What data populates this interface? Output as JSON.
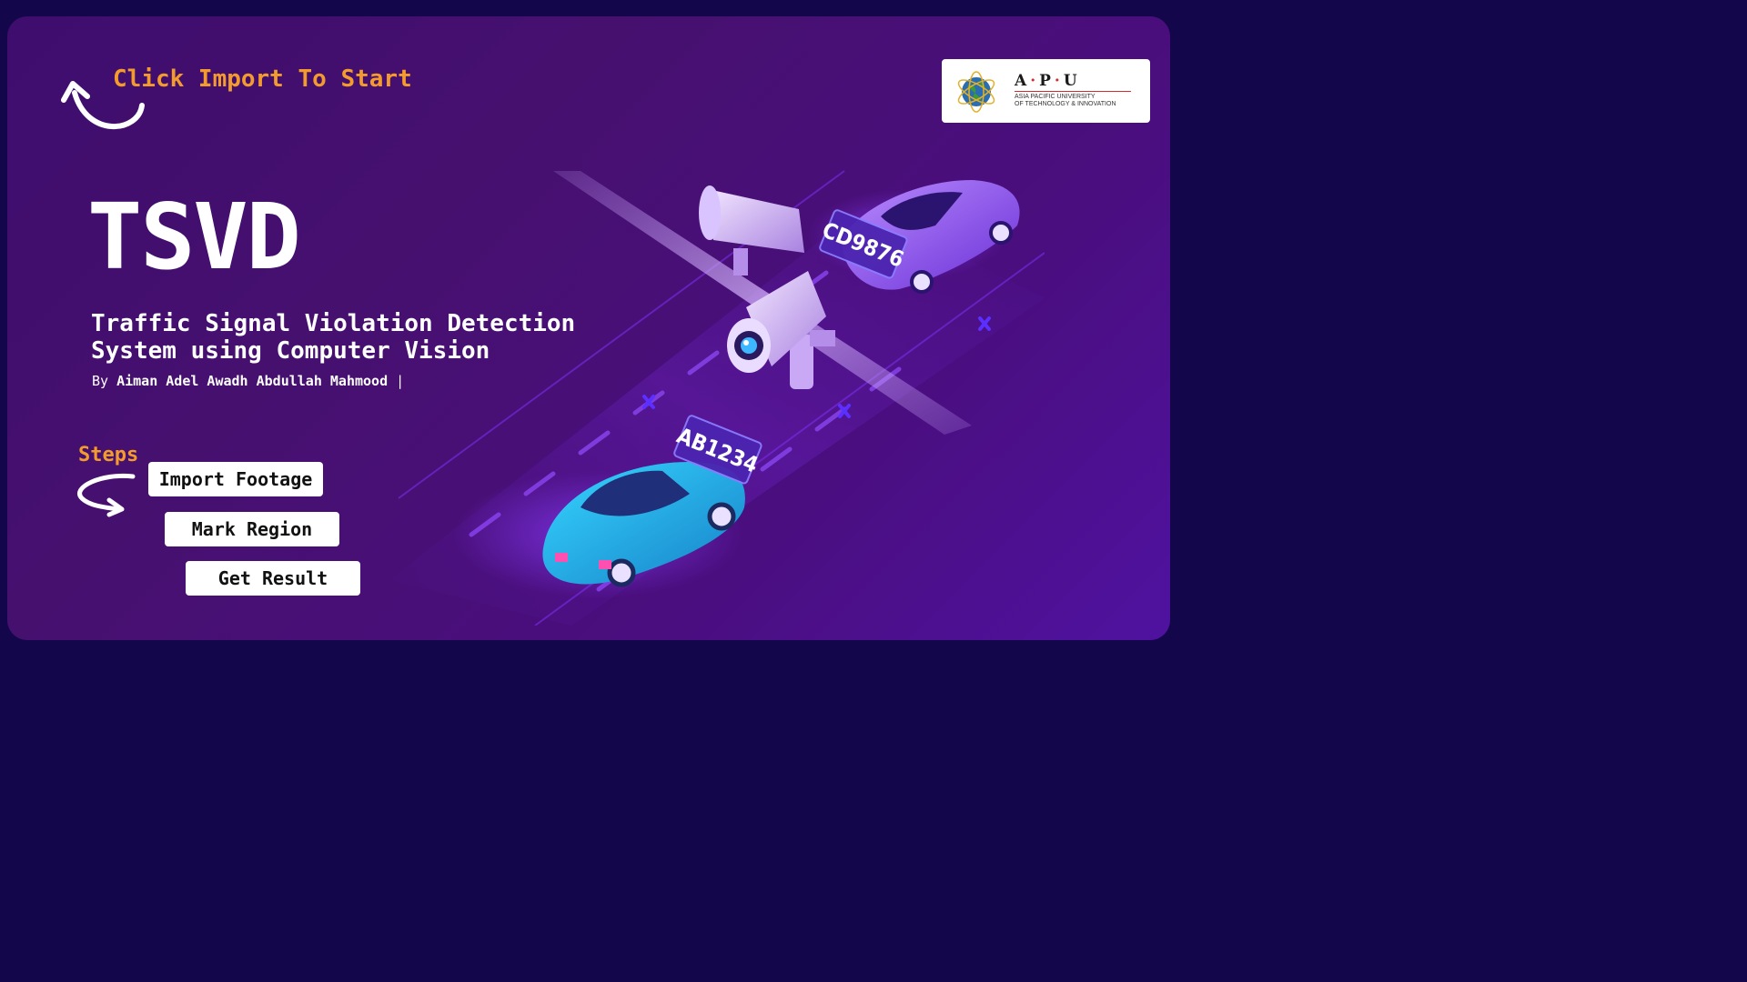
{
  "hint": {
    "text": "Click Import To Start",
    "icon": "curved-arrow-icon"
  },
  "logo": {
    "abbr_parts": [
      "A",
      "P",
      "U"
    ],
    "line1": "ASIA PACIFIC UNIVERSITY",
    "line2": "OF TECHNOLOGY & INNOVATION"
  },
  "title": "TSVD",
  "subtitle": {
    "line1": "Traffic Signal Violation Detection",
    "line2": "System using Computer Vision"
  },
  "byline": {
    "prefix": "By",
    "author": "Aiman Adel Awadh Abdullah Mahmood",
    "cursor": "|"
  },
  "steps": {
    "label": "Steps",
    "buttons": {
      "import": "Import Footage",
      "mark": "Mark Region",
      "result": "Get Result"
    }
  },
  "illustration": {
    "plate_front": "AB1234",
    "plate_back": "CD9876"
  },
  "colors": {
    "background": "#13064a",
    "panel": "#46106f",
    "accent": "#f39c2d",
    "button_bg": "#ffffff",
    "text": "#ffffff"
  }
}
